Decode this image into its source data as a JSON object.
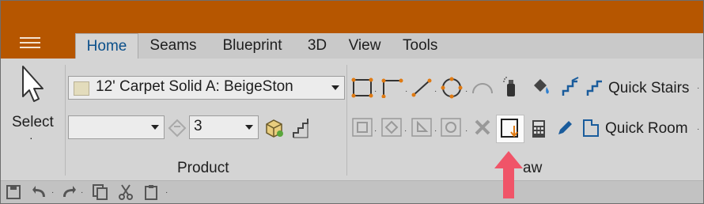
{
  "tabs": [
    {
      "label": "Home",
      "active": true
    },
    {
      "label": "Seams",
      "active": false
    },
    {
      "label": "Blueprint",
      "active": false
    },
    {
      "label": "3D",
      "active": false
    },
    {
      "label": "View",
      "active": false
    },
    {
      "label": "Tools",
      "active": false
    }
  ],
  "select": {
    "label": "Select",
    "caret": "·"
  },
  "product": {
    "material_value": "12' Carpet Solid A: BeigeSton",
    "swatch_color": "#e3dcbc",
    "second_combo_value": "",
    "number_combo_value": "3",
    "group_label": "Product"
  },
  "draw": {
    "quick_stairs_label": "Quick Stairs",
    "quick_room_label": "Quick Room",
    "group_label_visible": "aw"
  },
  "colors": {
    "titlebar": "#b65600",
    "accent_orange": "#e07a12",
    "arrow_red": "#f05468",
    "tab_active_text": "#0b4f8a"
  },
  "icons": [
    "menu-icon",
    "select-cursor-icon",
    "material-swatch-icon",
    "dropdown-arrow-icon",
    "paint-bucket-disabled-icon",
    "3d-box-icon",
    "stairs-plan-icon",
    "draw-rectangle-icon",
    "draw-polyline-icon",
    "draw-line-icon",
    "draw-circle-icon",
    "draw-arc-icon",
    "spray-icon",
    "fill-bucket-icon",
    "stairs-icon",
    "quick-stairs-icon",
    "square-icon",
    "diamond-icon",
    "triangle-icon",
    "circle-icon",
    "delete-x-icon",
    "quick-rectangle-icon",
    "calculator-icon",
    "pencil-icon",
    "quick-room-icon",
    "save-icon",
    "undo-icon",
    "redo-icon",
    "copy-icon",
    "cut-icon",
    "paste-icon",
    "red-pointer-arrow-icon"
  ]
}
